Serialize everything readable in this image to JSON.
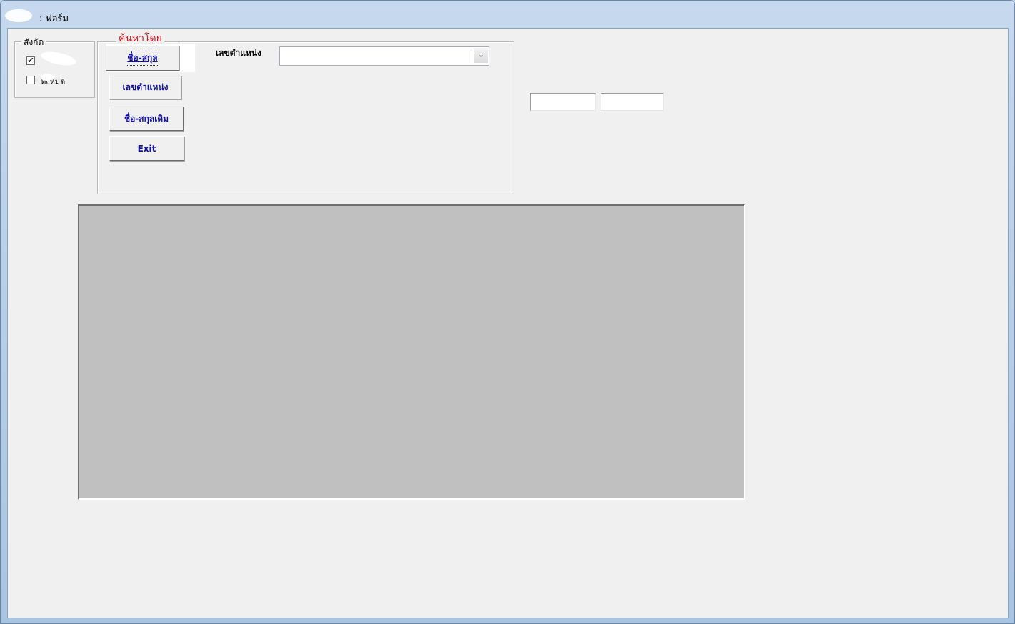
{
  "window": {
    "title": ": ฟอร์ม"
  },
  "affiliation_group": {
    "legend": "สังกัด",
    "checkboxes": [
      {
        "label": "",
        "checked": true
      },
      {
        "label": "ทั้งหมด",
        "checked": false
      }
    ]
  },
  "search_group": {
    "legend": "ค้นหาโดย",
    "legend_color": "#d0101a",
    "buttons": {
      "name": "ชื่อ-สกุล",
      "position_no": "เลขตำแหน่ง",
      "former_name": "ชื่อ-สกุลเดิม",
      "exit": "Exit"
    },
    "position_label": "เลขตำแหน่ง",
    "position_combo_value": ""
  },
  "textboxes": [
    "",
    ""
  ],
  "colors": {
    "button_text": "#1010a8",
    "grid_bg": "#c0c0c0",
    "client_bg": "#f0f0f0"
  }
}
